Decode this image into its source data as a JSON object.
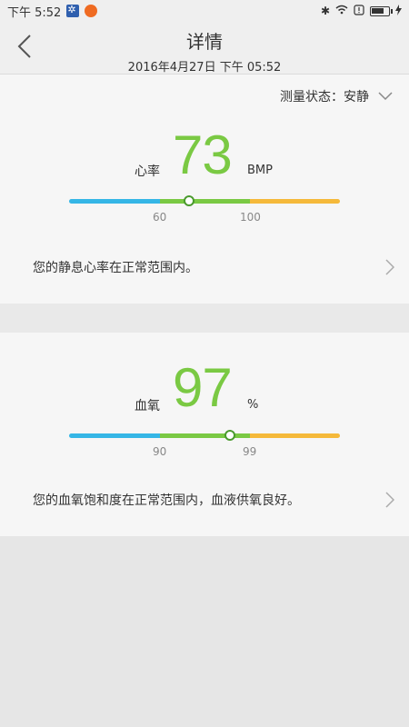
{
  "status": {
    "time": "下午 5:52"
  },
  "header": {
    "title": "详情",
    "subtitle": "2016年4月27日 下午 05:52"
  },
  "heart_rate": {
    "state_label": "测量状态：安静",
    "label": "心率",
    "value": "73",
    "unit": "BMP",
    "ticks": [
      "60",
      "100"
    ],
    "scale": {
      "min": 20,
      "max": 140,
      "value": 73
    },
    "message": "您的静息心率在正常范围内。"
  },
  "spo2": {
    "label": "血氧",
    "value": "97",
    "unit": "%",
    "ticks": [
      "90",
      "99"
    ],
    "scale": {
      "min": 81,
      "max": 108,
      "value": 97
    },
    "message": "您的血氧饱和度在正常范围内，血液供氧良好。"
  },
  "colors": {
    "accent_green": "#7ac943",
    "low_blue": "#35b6e6",
    "high_yellow": "#f5b93a"
  },
  "icons": {
    "back": "chevron-left-icon",
    "dropdown": "chevron-down-icon",
    "detail": "chevron-right-icon"
  }
}
